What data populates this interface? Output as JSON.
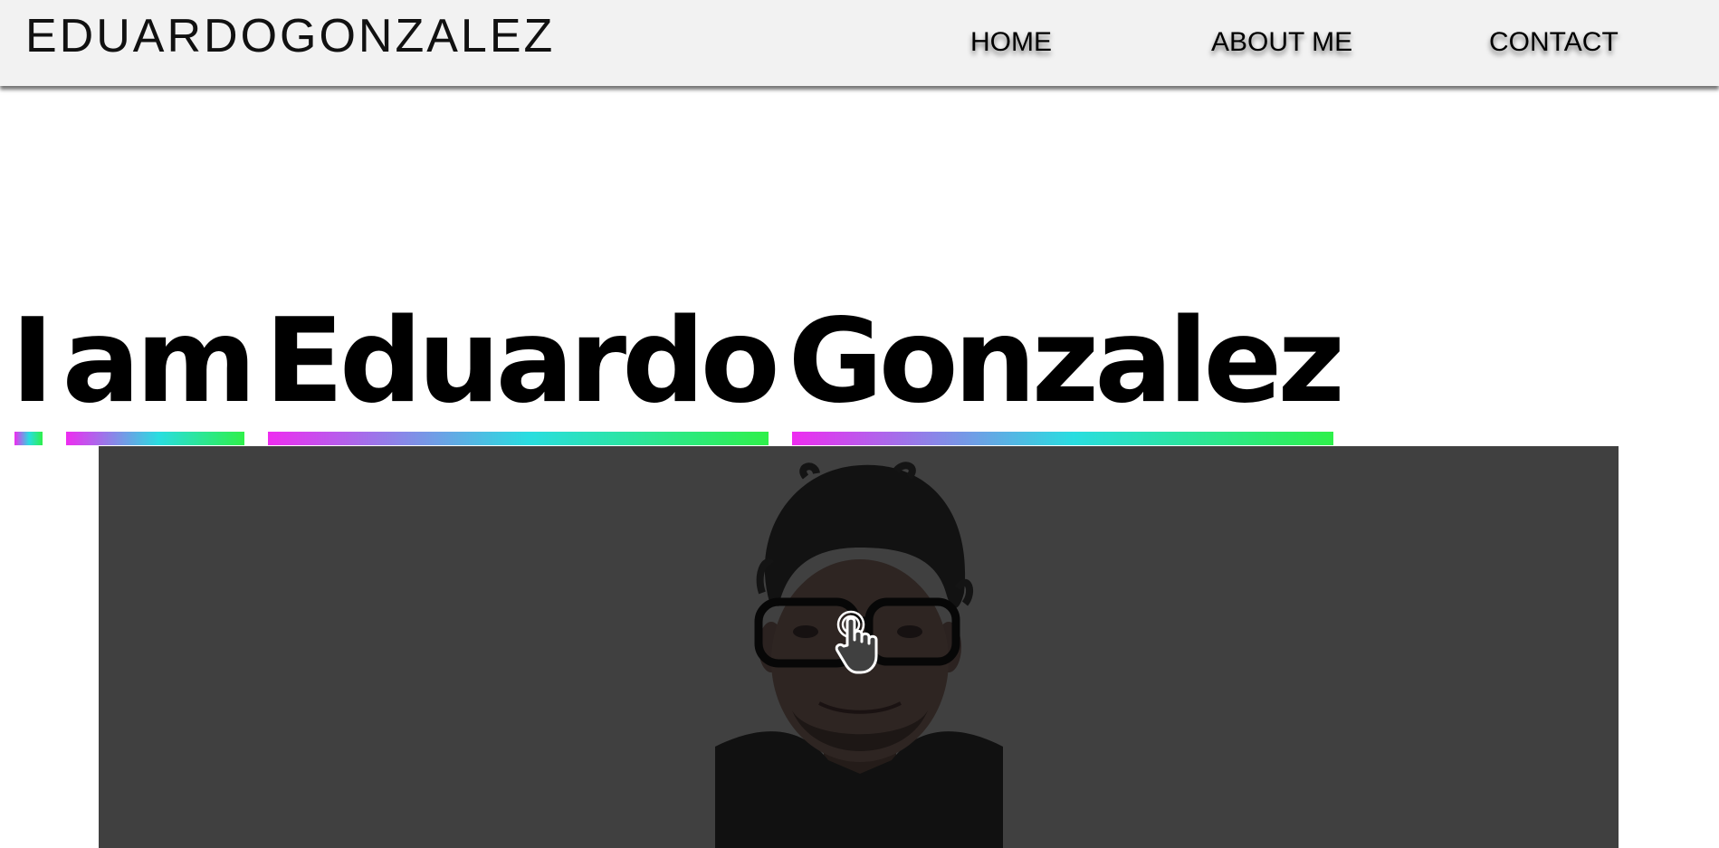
{
  "header": {
    "brand": "EDUARDOGONZALEZ",
    "nav": {
      "home": "HOME",
      "about": "ABOUT ME",
      "contact": "CONTACT"
    }
  },
  "hero": {
    "words": [
      "I",
      "am",
      "Eduardo",
      "Gonzalez"
    ]
  },
  "photo": {
    "background_color": "#404040",
    "cursor_icon": "hand-pointer-icon"
  },
  "colors": {
    "underline_gradient": [
      "#ee2cf0",
      "#29dde0",
      "#2ef04a"
    ],
    "header_background": "#f2f2f2"
  }
}
